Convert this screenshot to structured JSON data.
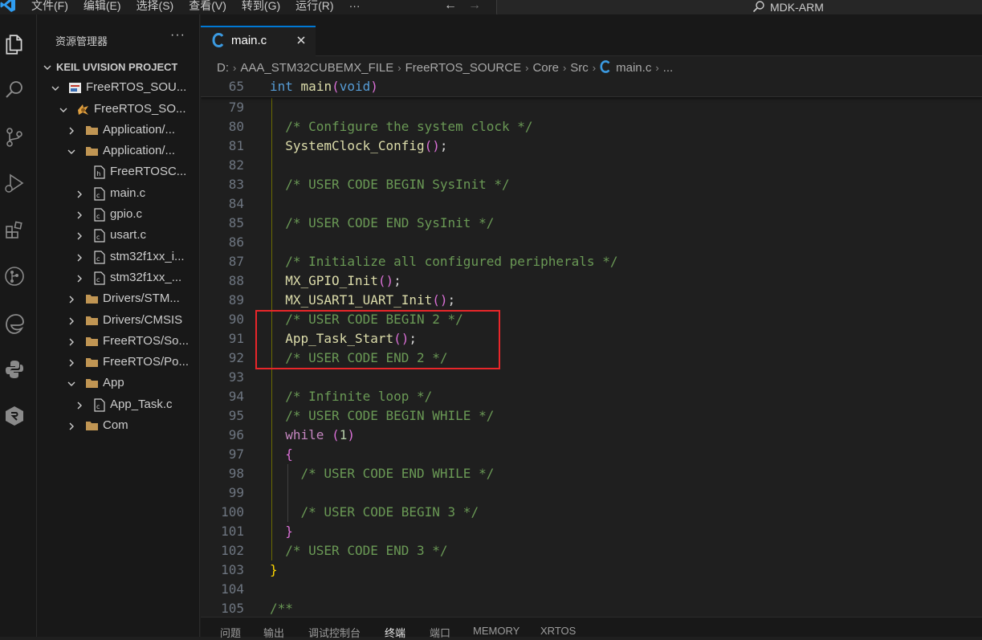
{
  "menu": [
    "文件(F)",
    "编辑(E)",
    "选择(S)",
    "查看(V)",
    "转到(G)",
    "运行(R)",
    "···"
  ],
  "nav": {
    "back": "←",
    "forward": "→"
  },
  "command_center": {
    "text": "MDK-ARM"
  },
  "explorer": {
    "title": "资源管理器",
    "more": "···",
    "section": "KEIL UVISION PROJECT",
    "items": [
      {
        "label": "FreeRTOS_SOU...",
        "depth": 1,
        "chevron": "down",
        "icon": "project-icon"
      },
      {
        "label": "FreeRTOS_SO...",
        "depth": 2,
        "chevron": "down",
        "icon": "target-icon"
      },
      {
        "label": "Application/...",
        "depth": 3,
        "chevron": "right",
        "icon": "folder-icon"
      },
      {
        "label": "Application/...",
        "depth": 3,
        "chevron": "down",
        "icon": "folder-icon"
      },
      {
        "label": "FreeRTOSC...",
        "depth": 4,
        "chevron": "none",
        "icon": "header-file-icon"
      },
      {
        "label": "main.c",
        "depth": 4,
        "chevron": "right",
        "icon": "c-file-icon"
      },
      {
        "label": "gpio.c",
        "depth": 4,
        "chevron": "right",
        "icon": "c-file-icon"
      },
      {
        "label": "usart.c",
        "depth": 4,
        "chevron": "right",
        "icon": "c-file-icon"
      },
      {
        "label": "stm32f1xx_i...",
        "depth": 4,
        "chevron": "right",
        "icon": "c-file-icon"
      },
      {
        "label": "stm32f1xx_...",
        "depth": 4,
        "chevron": "right",
        "icon": "c-file-icon"
      },
      {
        "label": "Drivers/STM...",
        "depth": 3,
        "chevron": "right",
        "icon": "folder-icon"
      },
      {
        "label": "Drivers/CMSIS",
        "depth": 3,
        "chevron": "right",
        "icon": "folder-icon"
      },
      {
        "label": "FreeRTOS/So...",
        "depth": 3,
        "chevron": "right",
        "icon": "folder-icon"
      },
      {
        "label": "FreeRTOS/Po...",
        "depth": 3,
        "chevron": "right",
        "icon": "folder-icon"
      },
      {
        "label": "App",
        "depth": 3,
        "chevron": "down",
        "icon": "folder-icon"
      },
      {
        "label": "App_Task.c",
        "depth": 4,
        "chevron": "right",
        "icon": "c-file-icon"
      },
      {
        "label": "Com",
        "depth": 3,
        "chevron": "right",
        "icon": "folder-icon"
      }
    ]
  },
  "tab": {
    "label": "main.c",
    "close": "×"
  },
  "breadcrumb": [
    "D:",
    "AAA_STM32CUBEMX_FILE",
    "FreeRTOS_SOURCE",
    "Core",
    "Src",
    "main.c",
    "..."
  ],
  "sticky_line": {
    "num": "65",
    "tokens": [
      [
        "kw",
        "int"
      ],
      [
        "plain",
        " "
      ],
      [
        "fn",
        "main"
      ],
      [
        "paren",
        "("
      ],
      [
        "kw",
        "void"
      ],
      [
        "paren",
        ")"
      ]
    ]
  },
  "code_lines": [
    {
      "num": "79",
      "indent": 1,
      "tokens": []
    },
    {
      "num": "80",
      "indent": 1,
      "tokens": [
        [
          "comment",
          "/* Configure the system clock */"
        ]
      ]
    },
    {
      "num": "81",
      "indent": 1,
      "tokens": [
        [
          "fn",
          "SystemClock_Config"
        ],
        [
          "paren",
          "()"
        ],
        [
          "plain",
          ";"
        ]
      ]
    },
    {
      "num": "82",
      "indent": 1,
      "tokens": []
    },
    {
      "num": "83",
      "indent": 1,
      "tokens": [
        [
          "comment",
          "/* USER CODE BEGIN SysInit */"
        ]
      ]
    },
    {
      "num": "84",
      "indent": 1,
      "tokens": []
    },
    {
      "num": "85",
      "indent": 1,
      "tokens": [
        [
          "comment",
          "/* USER CODE END SysInit */"
        ]
      ]
    },
    {
      "num": "86",
      "indent": 1,
      "tokens": []
    },
    {
      "num": "87",
      "indent": 1,
      "tokens": [
        [
          "comment",
          "/* Initialize all configured peripherals */"
        ]
      ]
    },
    {
      "num": "88",
      "indent": 1,
      "tokens": [
        [
          "fn",
          "MX_GPIO_Init"
        ],
        [
          "paren",
          "()"
        ],
        [
          "plain",
          ";"
        ]
      ]
    },
    {
      "num": "89",
      "indent": 1,
      "tokens": [
        [
          "fn",
          "MX_USART1_UART_Init"
        ],
        [
          "paren",
          "()"
        ],
        [
          "plain",
          ";"
        ]
      ]
    },
    {
      "num": "90",
      "indent": 1,
      "tokens": [
        [
          "comment",
          "/* USER CODE BEGIN 2 */"
        ]
      ]
    },
    {
      "num": "91",
      "indent": 1,
      "tokens": [
        [
          "fn",
          "App_Task_Start"
        ],
        [
          "paren",
          "()"
        ],
        [
          "plain",
          ";"
        ]
      ]
    },
    {
      "num": "92",
      "indent": 1,
      "tokens": [
        [
          "comment",
          "/* USER CODE END 2 */"
        ]
      ]
    },
    {
      "num": "93",
      "indent": 1,
      "tokens": []
    },
    {
      "num": "94",
      "indent": 1,
      "tokens": [
        [
          "comment",
          "/* Infinite loop */"
        ]
      ]
    },
    {
      "num": "95",
      "indent": 1,
      "tokens": [
        [
          "comment",
          "/* USER CODE BEGIN WHILE */"
        ]
      ]
    },
    {
      "num": "96",
      "indent": 1,
      "tokens": [
        [
          "ctrl",
          "while"
        ],
        [
          "plain",
          " "
        ],
        [
          "paren",
          "("
        ],
        [
          "num",
          "1"
        ],
        [
          "paren",
          ")"
        ]
      ]
    },
    {
      "num": "97",
      "indent": 1,
      "tokens": [
        [
          "paren",
          "{"
        ]
      ]
    },
    {
      "num": "98",
      "indent": 2,
      "tokens": [
        [
          "comment",
          "/* USER CODE END WHILE */"
        ]
      ]
    },
    {
      "num": "99",
      "indent": 2,
      "tokens": []
    },
    {
      "num": "100",
      "indent": 2,
      "tokens": [
        [
          "comment",
          "/* USER CODE BEGIN 3 */"
        ]
      ]
    },
    {
      "num": "101",
      "indent": 1,
      "tokens": [
        [
          "paren",
          "}"
        ]
      ]
    },
    {
      "num": "102",
      "indent": 1,
      "tokens": [
        [
          "comment",
          "/* USER CODE END 3 */"
        ]
      ]
    },
    {
      "num": "103",
      "indent": 0,
      "tokens": [
        [
          "brace",
          "}"
        ]
      ]
    },
    {
      "num": "104",
      "indent": 0,
      "tokens": []
    },
    {
      "num": "105",
      "indent": 0,
      "tokens": [
        [
          "comment",
          "/**"
        ]
      ]
    }
  ],
  "panel_tabs": [
    {
      "label": "问题",
      "active": false
    },
    {
      "label": "输出",
      "active": false
    },
    {
      "label": "调试控制台",
      "active": false
    },
    {
      "label": "终端",
      "active": true
    },
    {
      "label": "端口",
      "active": false
    },
    {
      "label": "MEMORY",
      "active": false
    },
    {
      "label": "XRTOS",
      "active": false
    }
  ],
  "colors": {
    "accent": "#0078d4",
    "highlight_box": "#e8262a",
    "comment": "#6a9955",
    "function": "#dcdcaa",
    "keyword": "#569cd6"
  }
}
